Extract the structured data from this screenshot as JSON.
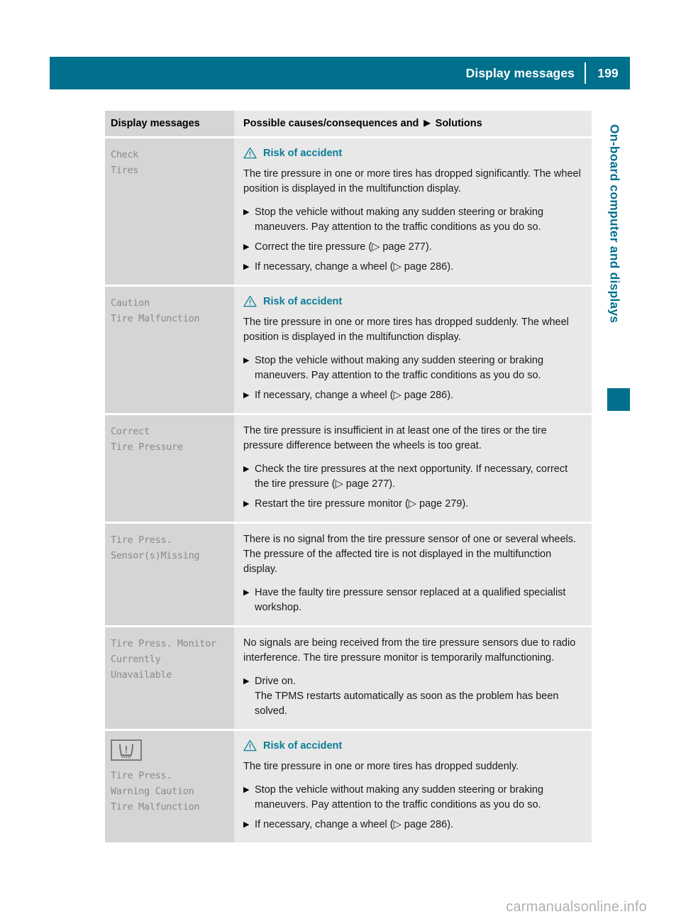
{
  "header": {
    "title": "Display messages",
    "page_number": "199",
    "band_color": "#00708d"
  },
  "side_tab": {
    "label": "On-board computer and displays",
    "color": "#00708d"
  },
  "table": {
    "headers": {
      "left": "Display messages",
      "right_before": "Possible causes/consequences and",
      "right_marker": "▶",
      "right_after": "Solutions"
    },
    "rows": [
      {
        "message": "Check\nTires",
        "warning": {
          "icon": "warning-triangle-icon",
          "label": "Risk of accident"
        },
        "paragraphs": [
          "The tire pressure in one or more tires has dropped significantly. The wheel position is displayed in the multifunction display."
        ],
        "steps": [
          {
            "text": "Stop the vehicle without making any sudden steering or braking maneuvers. Pay attention to the traffic conditions as you do so."
          },
          {
            "text": "Correct the tire pressure (▷ page 277)."
          },
          {
            "text": "If necessary, change a wheel (▷ page 286)."
          }
        ]
      },
      {
        "message": "Caution\nTire Malfunction",
        "warning": {
          "icon": "warning-triangle-icon",
          "label": "Risk of accident"
        },
        "paragraphs": [
          "The tire pressure in one or more tires has dropped suddenly. The wheel position is displayed in the multifunction display."
        ],
        "steps": [
          {
            "text": "Stop the vehicle without making any sudden steering or braking maneuvers. Pay attention to the traffic conditions as you do so."
          },
          {
            "text": "If necessary, change a wheel (▷ page 286)."
          }
        ]
      },
      {
        "message": "Correct\nTire Pressure",
        "warning": null,
        "paragraphs": [
          "The tire pressure is insufficient in at least one of the tires or the tire pressure difference between the wheels is too great."
        ],
        "steps": [
          {
            "text": "Check the tire pressures at the next opportunity. If necessary, correct the tire pressure (▷ page 277)."
          },
          {
            "text": "Restart the tire pressure monitor (▷ page 279)."
          }
        ]
      },
      {
        "message": "Tire Press.\nSensor(s)Missing",
        "warning": null,
        "paragraphs": [
          "There is no signal from the tire pressure sensor of one or several wheels. The pressure of the affected tire is not displayed in the multifunction display."
        ],
        "steps": [
          {
            "text": "Have the faulty tire pressure sensor replaced at a qualified specialist workshop."
          }
        ]
      },
      {
        "message": "Tire Press. Monitor\nCurrently\nUnavailable",
        "warning": null,
        "paragraphs": [
          "No signals are being received from the tire pressure sensors due to radio interference. The tire pressure monitor is temporarily malfunctioning."
        ],
        "steps": [
          {
            "text": "Drive on.",
            "continuation": "The TPMS restarts automatically as soon as the problem has been solved."
          }
        ]
      },
      {
        "message": "Tire Press.\nWarning Caution\nTire Malfunction",
        "icon": "tpms-warning-lamp-icon",
        "warning": {
          "icon": "warning-triangle-icon",
          "label": "Risk of accident"
        },
        "paragraphs": [
          "The tire pressure in one or more tires has dropped suddenly."
        ],
        "steps": [
          {
            "text": "Stop the vehicle without making any sudden steering or braking maneuvers. Pay attention to the traffic conditions as you do so."
          },
          {
            "text": "If necessary, change a wheel (▷ page 286)."
          }
        ]
      }
    ]
  },
  "watermark": "carmanualsonline.info",
  "step_marker": "▶"
}
